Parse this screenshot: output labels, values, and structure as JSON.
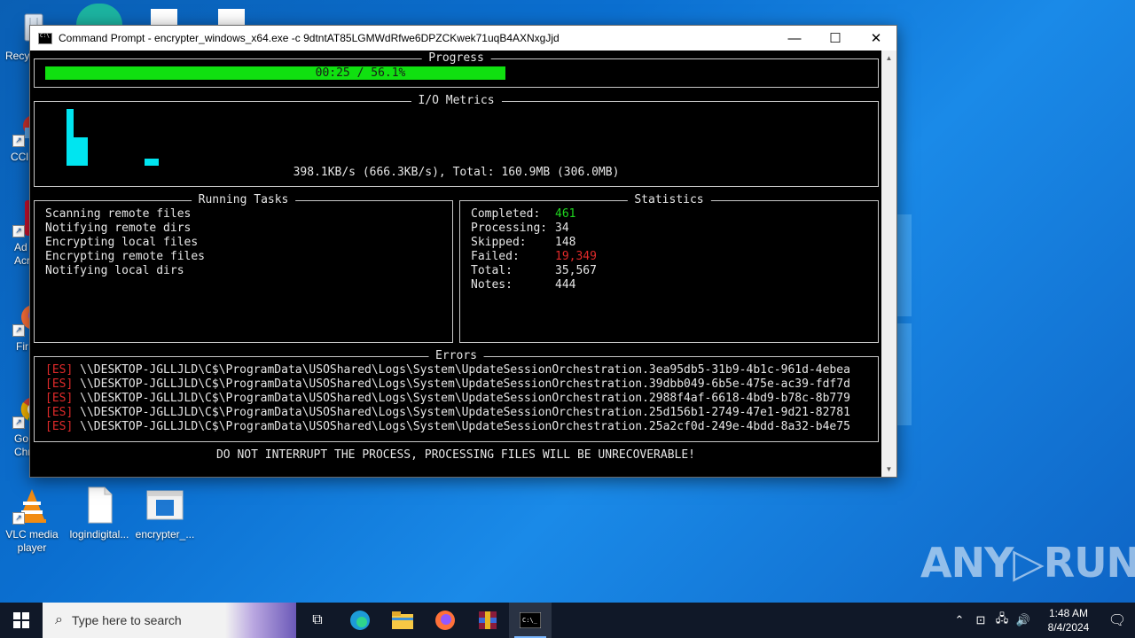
{
  "window": {
    "title": "Command Prompt - encrypter_windows_x64.exe  -c 9dtntAT85LGMWdRfwe6DPZCKwek71uqB4AXNxgJjd",
    "minimize_glyph": "—",
    "maximize_glyph": "☐",
    "close_glyph": "✕"
  },
  "progress": {
    "title": "Progress",
    "text": "00:25 / 56.1%",
    "percent": 56.1
  },
  "io_metrics": {
    "title": "I/O Metrics",
    "text": "398.1KB/s (666.3KB/s), Total: 160.9MB (306.0MB)"
  },
  "running_tasks": {
    "title": "Running Tasks",
    "items": [
      "Scanning remote files",
      "Notifying remote dirs",
      "Encrypting local files",
      "Encrypting remote files",
      "Notifying local dirs"
    ]
  },
  "statistics": {
    "title": "Statistics",
    "rows": [
      {
        "label": "Completed:",
        "value": "461"
      },
      {
        "label": "Processing:",
        "value": "34"
      },
      {
        "label": "Skipped:",
        "value": "148"
      },
      {
        "label": "Failed:",
        "value": "19,349"
      },
      {
        "label": "Total:",
        "value": "35,567"
      },
      {
        "label": "Notes:",
        "value": "444"
      }
    ]
  },
  "errors": {
    "title": "Errors",
    "tag": "[ES]",
    "lines": [
      "\\\\DESKTOP-JGLLJLD\\C$\\ProgramData\\USOShared\\Logs\\System\\UpdateSessionOrchestration.3ea95db5-31b9-4b1c-961d-4ebea",
      "\\\\DESKTOP-JGLLJLD\\C$\\ProgramData\\USOShared\\Logs\\System\\UpdateSessionOrchestration.39dbb049-6b5e-475e-ac39-fdf7d",
      "\\\\DESKTOP-JGLLJLD\\C$\\ProgramData\\USOShared\\Logs\\System\\UpdateSessionOrchestration.2988f4af-6618-4bd9-b78c-8b779",
      "\\\\DESKTOP-JGLLJLD\\C$\\ProgramData\\USOShared\\Logs\\System\\UpdateSessionOrchestration.25d156b1-2749-47e1-9d21-82781",
      "\\\\DESKTOP-JGLLJLD\\C$\\ProgramData\\USOShared\\Logs\\System\\UpdateSessionOrchestration.25a2cf0d-249e-4bdd-8a32-b4e75"
    ]
  },
  "warning": "DO NOT INTERRUPT THE PROCESS, PROCESSING FILES WILL BE UNRECOVERABLE!",
  "desktop": {
    "icons": [
      {
        "label": "Recy",
        "icon": "recycle-bin-icon"
      },
      {
        "label": "CCl",
        "icon": "ccleaner-icon"
      },
      {
        "label": "Ad\nAcr",
        "icon": "acrobat-icon"
      },
      {
        "label": "Fir",
        "icon": "firefox-icon"
      },
      {
        "label": "Go\nChr",
        "icon": "chrome-icon"
      },
      {
        "label": "VLC media\nplayer",
        "icon": "vlc-icon"
      },
      {
        "label": "logindigital...",
        "icon": "file-icon"
      },
      {
        "label": "encrypter_...",
        "icon": "exe-icon"
      }
    ]
  },
  "taskbar": {
    "search_placeholder": "Type here to search",
    "time": "1:48 AM",
    "date": "8/4/2024"
  },
  "watermark": "ANY▷RUN",
  "colors": {
    "progress_fill": "#10e010",
    "io_bars": "#00e5f0",
    "completed": "#1fd61f",
    "failed": "#e02a2a"
  }
}
